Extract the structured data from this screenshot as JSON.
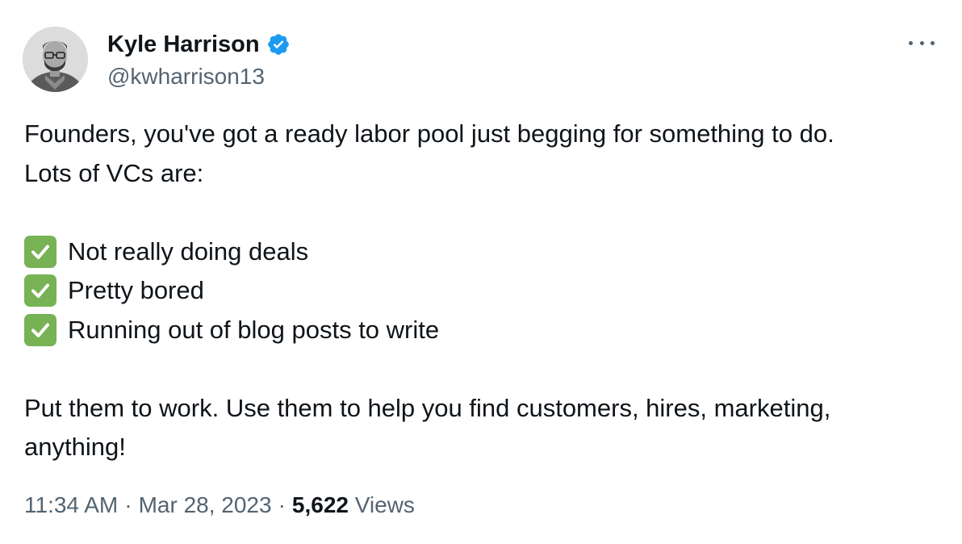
{
  "author": {
    "display_name": "Kyle Harrison",
    "handle": "@kwharrison13",
    "verified": true,
    "avatar_icon": "profile-photo",
    "verified_color": "#1d9bf0"
  },
  "tweet": {
    "intro_line_1": "Founders, you've got a ready labor pool just begging for something to do.",
    "intro_line_2": "Lots of VCs are:",
    "checklist": [
      "Not really doing deals",
      "Pretty bored",
      "Running out of blog posts to write"
    ],
    "check_icon": "white-check-mark-emoji",
    "outro_line_1": "Put them to work. Use them to help you find customers, hires, marketing,",
    "outro_line_2": "anything!"
  },
  "meta": {
    "time": "11:34 AM",
    "separator": "·",
    "date": "Mar 28, 2023",
    "views_count": "5,622",
    "views_label": "Views"
  },
  "colors": {
    "text_primary": "#0f1419",
    "text_secondary": "#536471",
    "check_green": "#77b255"
  }
}
